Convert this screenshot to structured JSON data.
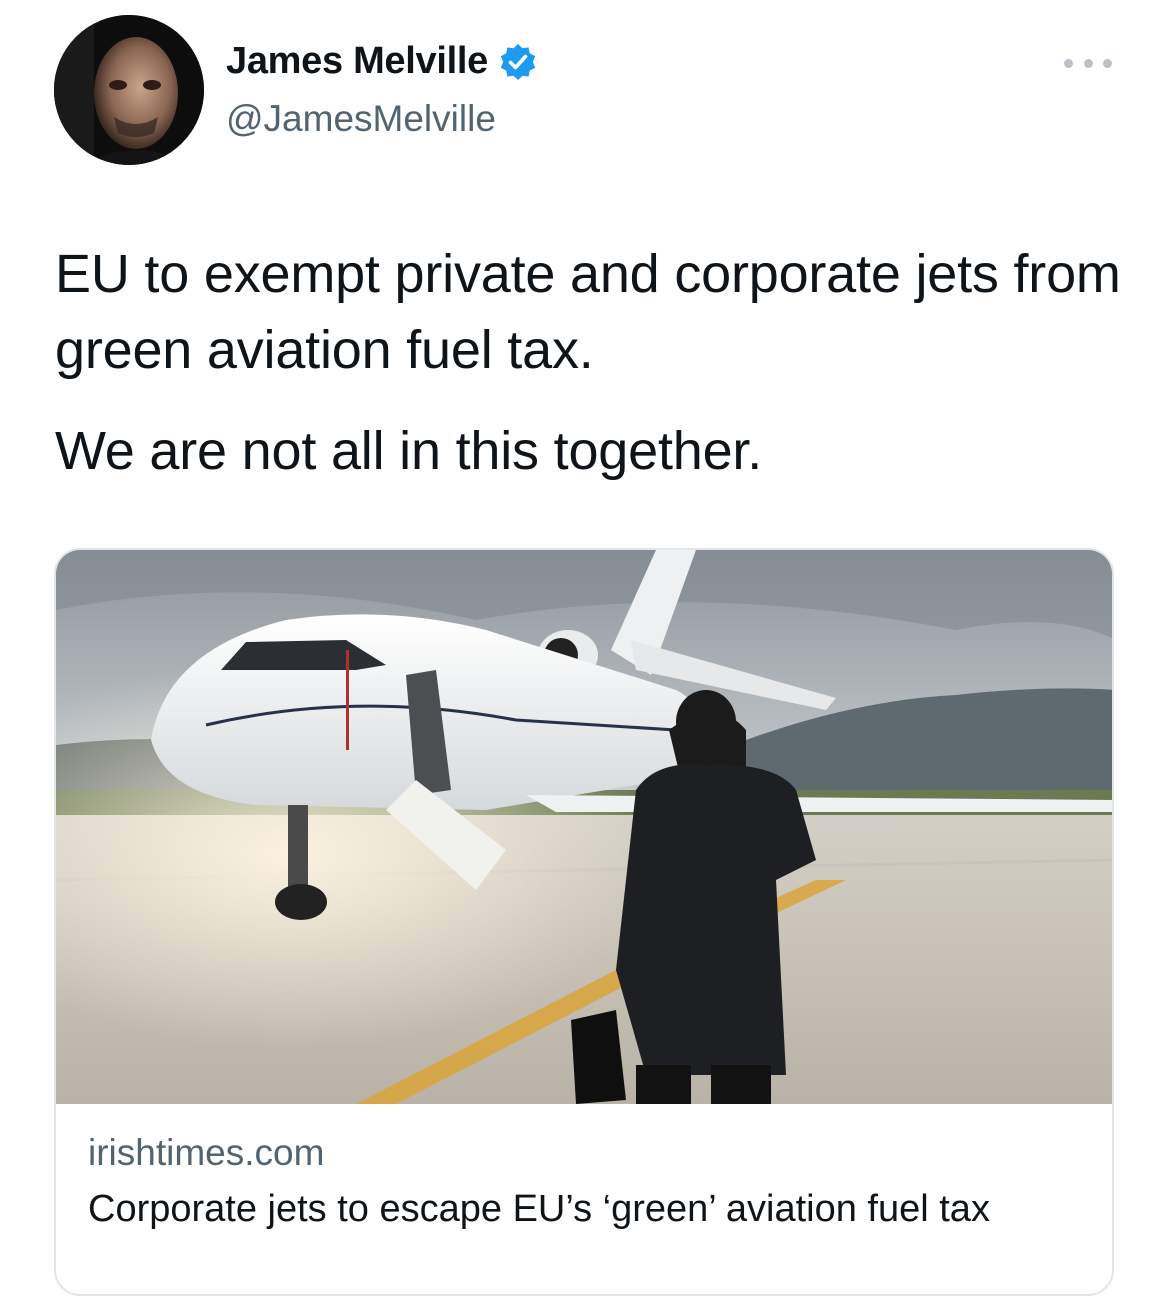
{
  "author": {
    "display_name": "James Melville",
    "handle": "@JamesMelville",
    "verified": true,
    "verified_color": "#1d9bf0"
  },
  "tweet": {
    "paragraphs": [
      "EU to exempt private and corporate jets from green aviation fuel tax.",
      "We are not all in this together."
    ]
  },
  "card": {
    "domain": "irishtimes.com",
    "title": "Corporate jets to escape EU’s ‘green’ aviation fuel tax"
  },
  "icons": {
    "verified": "verified-badge-icon",
    "more": "more-options-icon"
  }
}
